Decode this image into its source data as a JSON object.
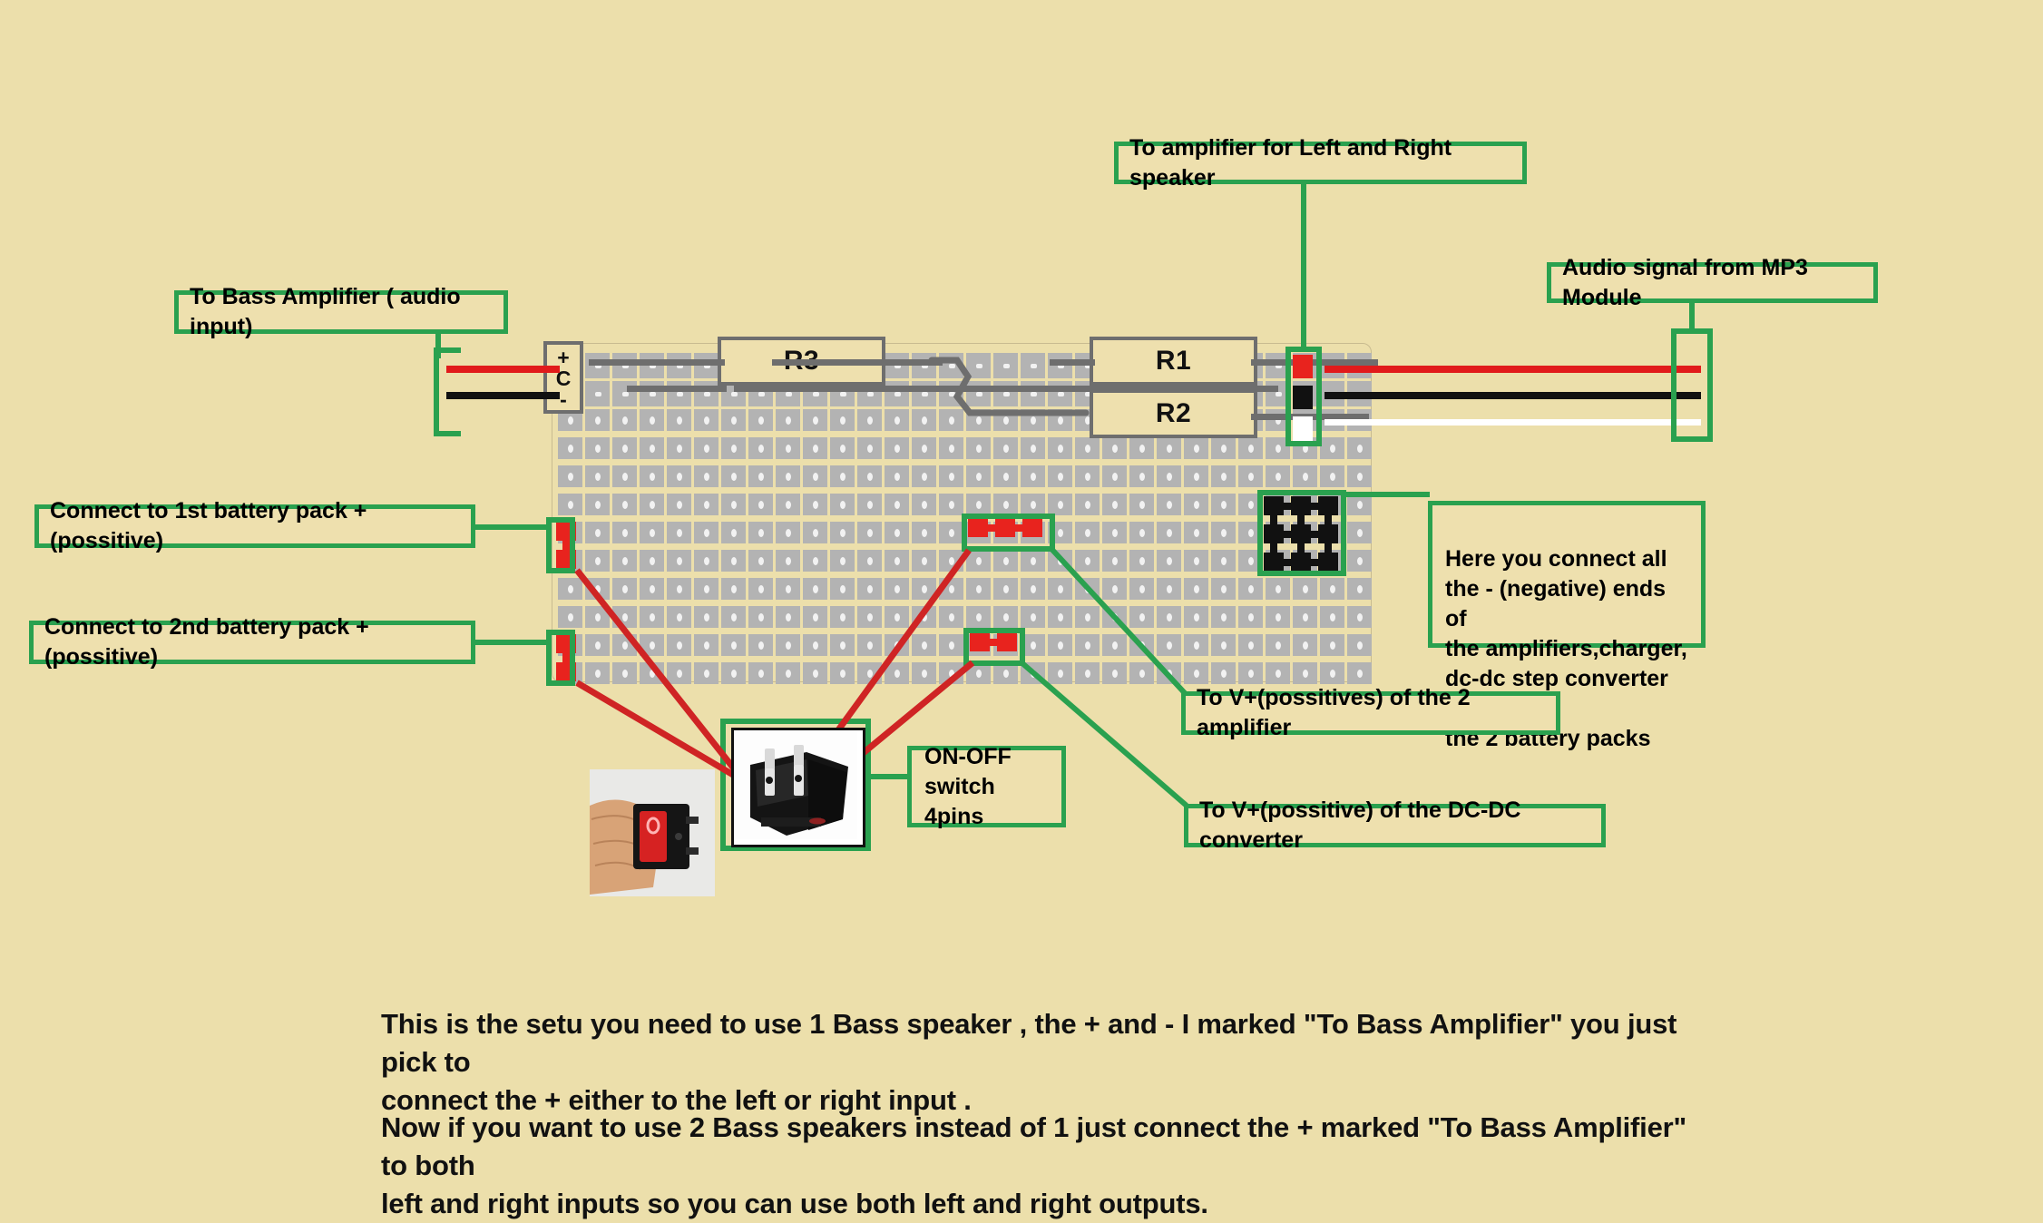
{
  "page": {
    "background_color": "#ecdfab",
    "accent_color": "#2aa14f",
    "wire_red": "#e11b1b",
    "wire_black": "#111111",
    "wire_white": "#ffffff"
  },
  "callouts": {
    "amp_left_right": "To amplifier for Left and Right speaker",
    "mp3_module": "Audio signal from MP3 Module",
    "bass_amp_input": "To Bass Amplifier ( audio input)",
    "battery_1": "Connect to 1st battery pack +(possitive)",
    "battery_2": "Connect to 2nd battery pack +(possitive)",
    "negative_bus": "Here you connect all\nthe - (negative) ends of\nthe  amplifiers,charger,\ndc-dc step converter and\nthe 2 battery packs",
    "v_plus_amplifiers": "To V+(possitives) of the 2 amplifier",
    "v_plus_dcdc": "To V+(possitive) of the DC-DC converter",
    "switch": "ON-OFF\n  switch 4pins"
  },
  "breadboard": {
    "components": [
      {
        "name": "R3",
        "label": "R3"
      },
      {
        "name": "R1",
        "label": "R1"
      },
      {
        "name": "R2",
        "label": "R2"
      }
    ],
    "capacitor": {
      "plus": "+",
      "body": "C",
      "minus": "-"
    }
  },
  "body_text": {
    "paragraph_1_line_1": "This is the setu you need to use 1 Bass speaker , the + and - I marked \"To Bass Amplifier\" you just pick to",
    "paragraph_1_line_2": "connect the + either to the left or right input .",
    "paragraph_2_line_1": "Now if you want to use 2 Bass speakers instead of 1 just connect the + marked \"To Bass Amplifier\" to both",
    "paragraph_2_line_2": "left and right inputs so you can use both left and right outputs."
  }
}
